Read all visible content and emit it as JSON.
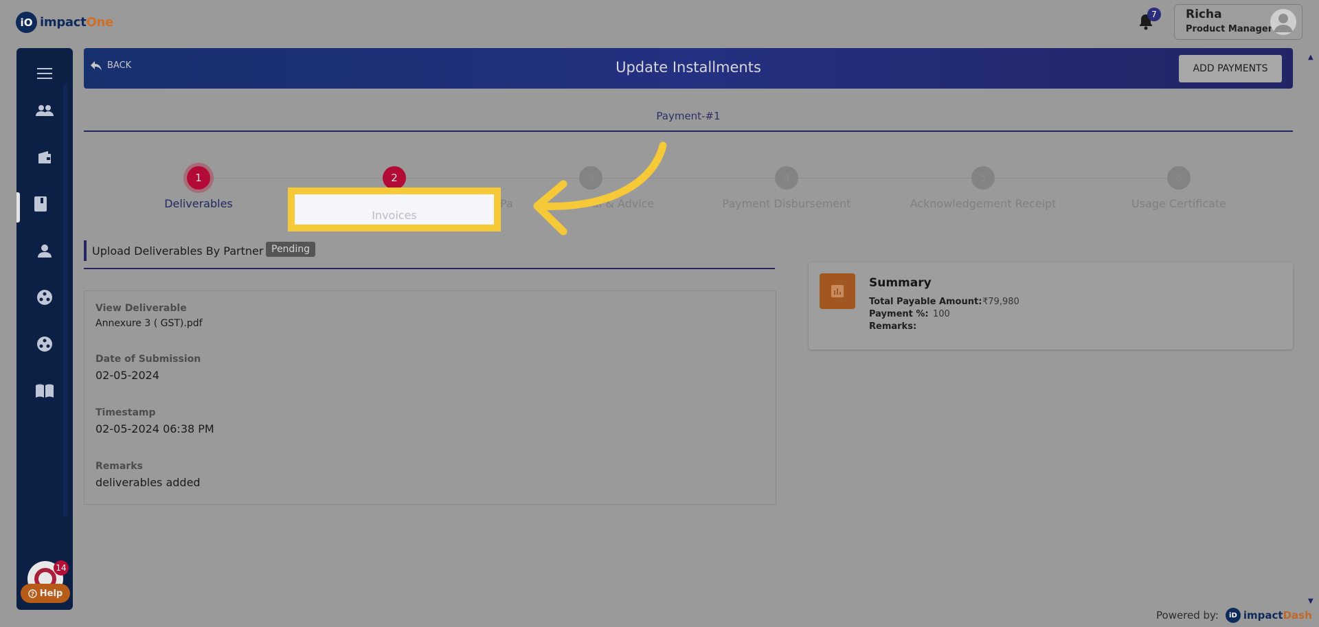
{
  "app": {
    "logo_mark": "iO",
    "logo_text_a": "impact",
    "logo_text_b": "One"
  },
  "header": {
    "notification_count": "7",
    "user_name": "Richa",
    "user_role": "Product Manager"
  },
  "sidebar": {
    "items": [
      {
        "icon": "menu-icon"
      },
      {
        "icon": "users-icon"
      },
      {
        "icon": "wallet-icon"
      },
      {
        "icon": "book-icon",
        "active": true
      },
      {
        "icon": "person-icon"
      },
      {
        "icon": "group-icon"
      },
      {
        "icon": "group-icon"
      },
      {
        "icon": "open-book-icon"
      }
    ],
    "bottom_badge": "14",
    "help_label": "Help"
  },
  "banner": {
    "back_label": "BACK",
    "title": "Update Installments",
    "add_payments_label": "ADD PAYMENTS"
  },
  "tab": {
    "label": "Payment-#1"
  },
  "stepper": {
    "steps": [
      {
        "number": "1",
        "label": "Deliverables",
        "state": "done"
      },
      {
        "number": "2",
        "label": "Invoices",
        "state": "current"
      },
      {
        "number": "3",
        "label": "Payment Approval & Advice",
        "state": "pending",
        "visible_label_tail": "Pa"
      },
      {
        "number": "4",
        "label": "Payment Disbursement",
        "state": "pending"
      },
      {
        "number": "5",
        "label": "Acknowledgement Receipt",
        "state": "pending"
      },
      {
        "number": "6",
        "label": "Usage Certificate",
        "state": "pending"
      }
    ],
    "step3_suffix": "al & Advice"
  },
  "section": {
    "title": "Upload Deliverables By Partner",
    "status": "Pending"
  },
  "details": {
    "view_deliverable_label": "View Deliverable",
    "view_deliverable_value": "Annexure 3 ( GST).pdf",
    "date_label": "Date of Submission",
    "date_value": "02-05-2024",
    "timestamp_label": "Timestamp",
    "timestamp_value": "02-05-2024 06:38 PM",
    "remarks_label": "Remarks",
    "remarks_value": "deliverables added"
  },
  "summary": {
    "title": "Summary",
    "total_label": "Total Payable Amount:",
    "total_value": "₹79,980",
    "percent_label": "Payment %:",
    "percent_value": "100",
    "remarks_label": "Remarks:"
  },
  "footer": {
    "powered_label": "Powered by:",
    "brand_mark": "iD",
    "brand_a": "impact",
    "brand_b": "Dash"
  },
  "colors": {
    "highlight": "#f5c938",
    "step_active": "#b20b37",
    "banner": "#243081"
  }
}
